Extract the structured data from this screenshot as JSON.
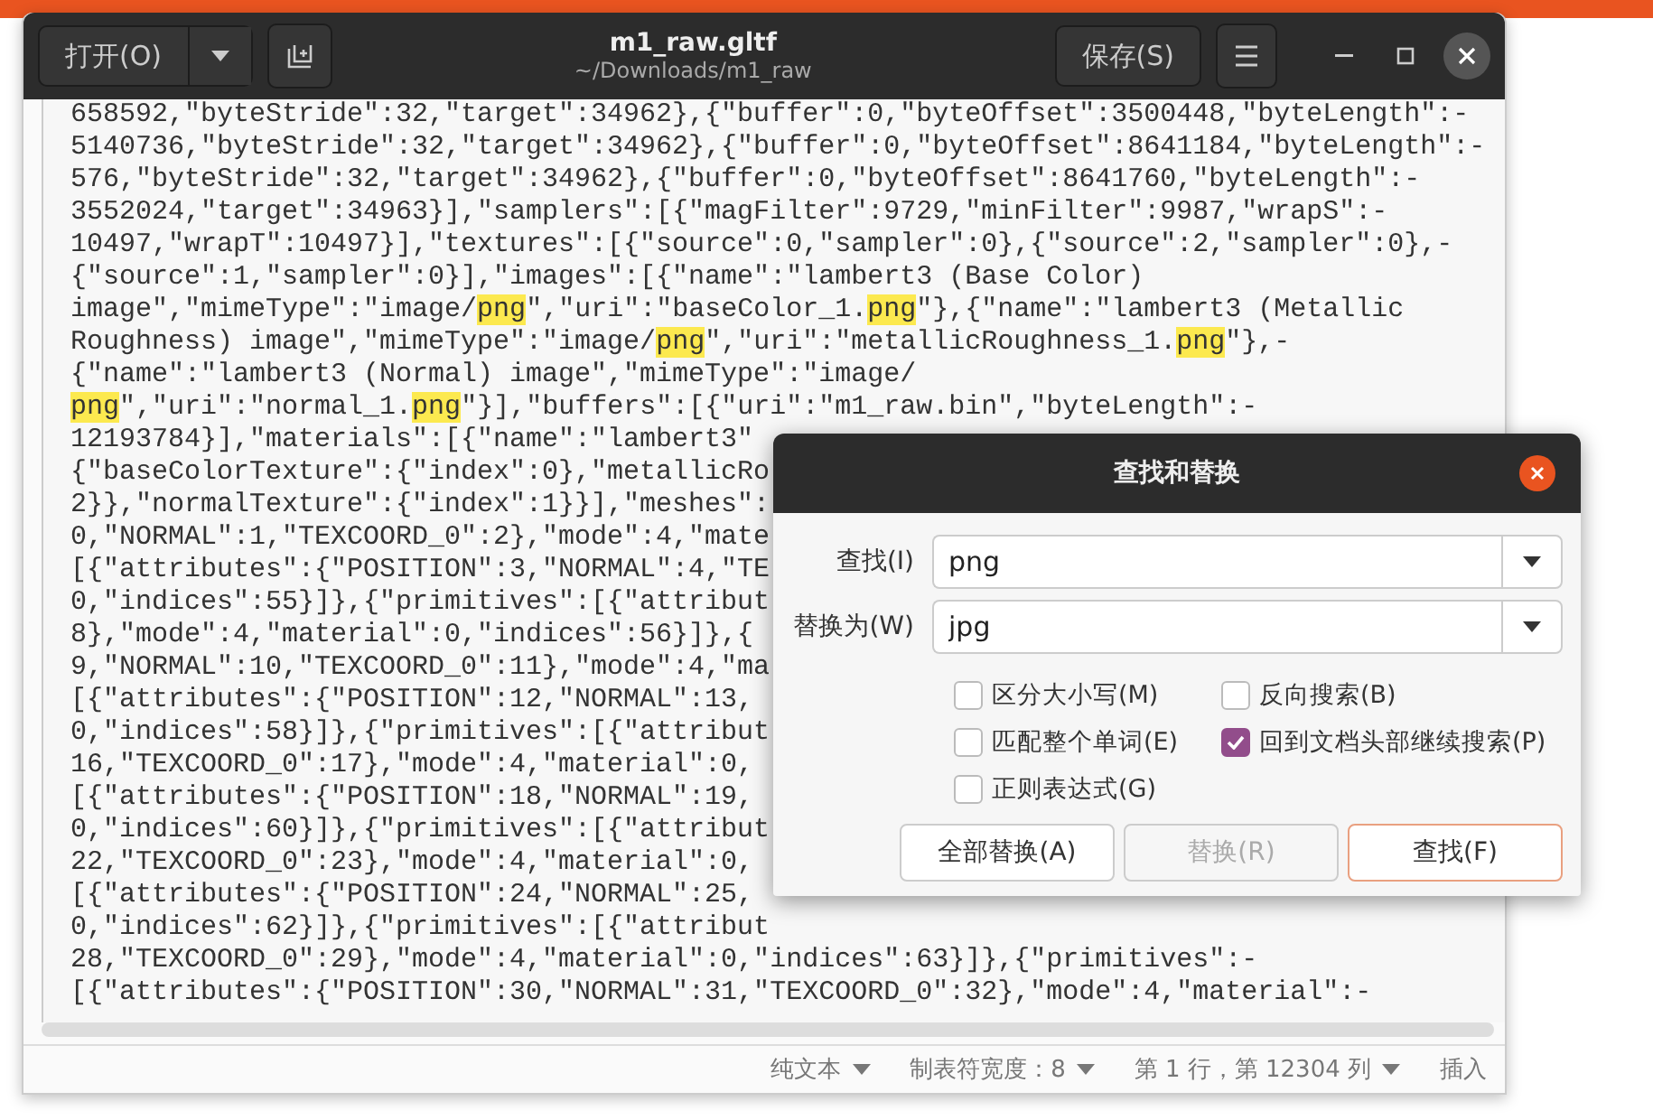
{
  "window": {
    "title": "m1_raw.gltf",
    "subtitle": "~/Downloads/m1_raw",
    "open_button": "打开(O)",
    "save_button": "保存(S)"
  },
  "editor": {
    "lines": [
      {
        "parts": [
          {
            "text": "658592,\"byteStride\":32,\"target\":34962},{\"buffer\":0,\"byteOffset\":3500448,\"byteLength\":-",
            "match": false
          }
        ]
      },
      {
        "parts": [
          {
            "text": "5140736,\"byteStride\":32,\"target\":34962},{\"buffer\":0,\"byteOffset\":8641184,\"byteLength\":-",
            "match": false
          }
        ]
      },
      {
        "parts": [
          {
            "text": "576,\"byteStride\":32,\"target\":34962},{\"buffer\":0,\"byteOffset\":8641760,\"byteLength\":-",
            "match": false
          }
        ]
      },
      {
        "parts": [
          {
            "text": "3552024,\"target\":34963}],\"samplers\":[{\"magFilter\":9729,\"minFilter\":9987,\"wrapS\":-",
            "match": false
          }
        ]
      },
      {
        "parts": [
          {
            "text": "10497,\"wrapT\":10497}],\"textures\":[{\"source\":0,\"sampler\":0},{\"source\":2,\"sampler\":0},-",
            "match": false
          }
        ]
      },
      {
        "parts": [
          {
            "text": "{\"source\":1,\"sampler\":0}],\"images\":[{\"name\":\"lambert3 (Base Color)",
            "match": false
          }
        ]
      },
      {
        "parts": [
          {
            "text": "image\",\"mimeType\":\"image/",
            "match": false
          },
          {
            "text": "png",
            "match": true
          },
          {
            "text": "\",\"uri\":\"baseColor_1.",
            "match": false
          },
          {
            "text": "png",
            "match": true
          },
          {
            "text": "\"},{\"name\":\"lambert3 (Metallic",
            "match": false
          }
        ]
      },
      {
        "parts": [
          {
            "text": "Roughness) image\",\"mimeType\":\"image/",
            "match": false
          },
          {
            "text": "png",
            "match": true
          },
          {
            "text": "\",\"uri\":\"metallicRoughness_1.",
            "match": false
          },
          {
            "text": "png",
            "match": true
          },
          {
            "text": "\"},-",
            "match": false
          }
        ]
      },
      {
        "parts": [
          {
            "text": "{\"name\":\"lambert3 (Normal) image\",\"mimeType\":\"image/",
            "match": false
          }
        ]
      },
      {
        "parts": [
          {
            "text": "png",
            "match": true
          },
          {
            "text": "\",\"uri\":\"normal_1.",
            "match": false
          },
          {
            "text": "png",
            "match": true
          },
          {
            "text": "\"}],\"buffers\":[{\"uri\":\"m1_raw.bin\",\"byteLength\":-",
            "match": false
          }
        ]
      },
      {
        "parts": [
          {
            "text": "12193784}],\"materials\":[{\"name\":\"lambert3\"",
            "match": false
          }
        ]
      },
      {
        "parts": [
          {
            "text": "{\"baseColorTexture\":{\"index\":0},\"metallicRo",
            "match": false
          }
        ]
      },
      {
        "parts": [
          {
            "text": "2}},\"normalTexture\":{\"index\":1}}],\"meshes\":",
            "match": false
          }
        ]
      },
      {
        "parts": [
          {
            "text": "0,\"NORMAL\":1,\"TEXCOORD_0\":2},\"mode\":4,\"mate",
            "match": false
          }
        ]
      },
      {
        "parts": [
          {
            "text": "[{\"attributes\":{\"POSITION\":3,\"NORMAL\":4,\"TE",
            "match": false
          }
        ]
      },
      {
        "parts": [
          {
            "text": "0,\"indices\":55}]},{\"primitives\":[{\"attribut",
            "match": false
          }
        ]
      },
      {
        "parts": [
          {
            "text": "8},\"mode\":4,\"material\":0,\"indices\":56}]},{",
            "match": false
          }
        ]
      },
      {
        "parts": [
          {
            "text": "9,\"NORMAL\":10,\"TEXCOORD_0\":11},\"mode\":4,\"ma",
            "match": false
          }
        ]
      },
      {
        "parts": [
          {
            "text": "[{\"attributes\":{\"POSITION\":12,\"NORMAL\":13,",
            "match": false
          }
        ]
      },
      {
        "parts": [
          {
            "text": "0,\"indices\":58}]},{\"primitives\":[{\"attribut",
            "match": false
          }
        ]
      },
      {
        "parts": [
          {
            "text": "16,\"TEXCOORD_0\":17},\"mode\":4,\"material\":0,",
            "match": false
          }
        ]
      },
      {
        "parts": [
          {
            "text": "[{\"attributes\":{\"POSITION\":18,\"NORMAL\":19,",
            "match": false
          }
        ]
      },
      {
        "parts": [
          {
            "text": "0,\"indices\":60}]},{\"primitives\":[{\"attribut",
            "match": false
          }
        ]
      },
      {
        "parts": [
          {
            "text": "22,\"TEXCOORD_0\":23},\"mode\":4,\"material\":0,",
            "match": false
          }
        ]
      },
      {
        "parts": [
          {
            "text": "[{\"attributes\":{\"POSITION\":24,\"NORMAL\":25,",
            "match": false
          }
        ]
      },
      {
        "parts": [
          {
            "text": "0,\"indices\":62}]},{\"primitives\":[{\"attribut",
            "match": false
          }
        ]
      },
      {
        "parts": [
          {
            "text": "28,\"TEXCOORD_0\":29},\"mode\":4,\"material\":0,\"indices\":63}]},{\"primitives\":-",
            "match": false
          }
        ]
      },
      {
        "parts": [
          {
            "text": "[{\"attributes\":{\"POSITION\":30,\"NORMAL\":31,\"TEXCOORD_0\":32},\"mode\":4,\"material\":-",
            "match": false
          }
        ]
      }
    ]
  },
  "status_bar": {
    "items": [
      {
        "label": "纯文本",
        "dropdown": true
      },
      {
        "label": "制表符宽度：8",
        "dropdown": true
      },
      {
        "label": "第 1 行，第 12304 列",
        "dropdown": true
      },
      {
        "label": "插入",
        "dropdown": false
      }
    ]
  },
  "dialog": {
    "title": "查找和替换",
    "fields": [
      {
        "label": "查找(I)",
        "value": "png"
      },
      {
        "label": "替换为(W)",
        "value": "jpg"
      }
    ],
    "options": [
      {
        "label": "区分大小写(M)",
        "checked": false
      },
      {
        "label": "反向搜索(B)",
        "checked": false
      },
      {
        "label": "匹配整个单词(E)",
        "checked": false
      },
      {
        "label": "回到文档头部继续搜索(P)",
        "checked": true
      },
      {
        "label": "正则表达式(G)",
        "checked": false
      }
    ],
    "buttons": [
      {
        "label": "全部替换(A)",
        "disabled": false,
        "focused": false
      },
      {
        "label": "替换(R)",
        "disabled": true,
        "focused": false
      },
      {
        "label": "查找(F)",
        "disabled": false,
        "focused": true
      }
    ]
  }
}
